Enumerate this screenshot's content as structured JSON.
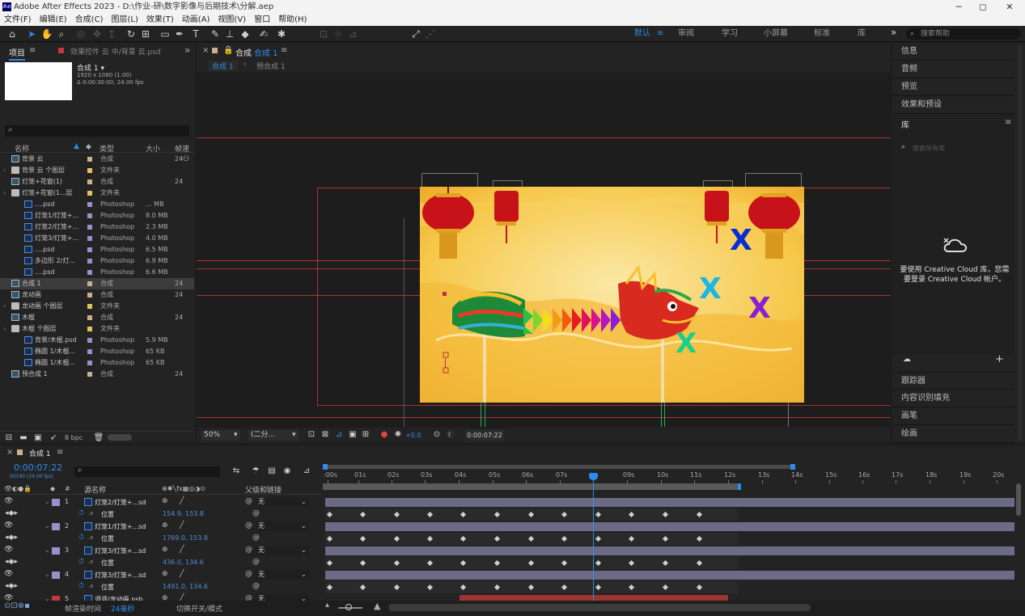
{
  "titlebar": {
    "app_badge": "Ae",
    "title": "Adobe After Effects 2023 - D:\\作业-研\\数字影像与后期技术\\分解.aep",
    "minimize": "─",
    "maximize": "◻",
    "close": "✕"
  },
  "menu": [
    "文件(F)",
    "编辑(E)",
    "合成(C)",
    "图层(L)",
    "效果(T)",
    "动画(A)",
    "视图(V)",
    "窗口",
    "帮助(H)"
  ],
  "toolbar": {
    "snap_label": "对齐",
    "workspaces": [
      "默认",
      "审阅",
      "学习",
      "小屏幕",
      "标准",
      "库"
    ],
    "search_placeholder": "搜索帮助",
    "more": "»"
  },
  "project": {
    "tab_project": "项目",
    "tab_effects": "效果控件 云 中/背景 云.psd",
    "more": "»",
    "comp_name": "合成 1 ▾",
    "comp_info1": "1920 x 1080 (1.00)",
    "comp_info2": "Δ 0:00:30:00, 24.00 fps",
    "search_icon": "⌕",
    "cols": {
      "name": "名称",
      "type": "类型",
      "size": "大小",
      "fr": "帧速"
    },
    "items": [
      {
        "name": "背景 云",
        "type": "合成",
        "size": "",
        "fr": "24",
        "icon": "comp",
        "indent": 0,
        "color": "#c8b18a"
      },
      {
        "name": "背景 云 个图层",
        "type": "文件夹",
        "size": "",
        "fr": "",
        "icon": "fold",
        "indent": 0,
        "color": "#e0c35b"
      },
      {
        "name": "灯笼+花窗(1)",
        "type": "合成",
        "size": "",
        "fr": "24",
        "icon": "comp",
        "indent": 0,
        "color": "#c8b18a"
      },
      {
        "name": "灯笼+花窗(1...层",
        "type": "文件夹",
        "size": "",
        "fr": "",
        "icon": "fold",
        "indent": 0,
        "color": "#e0c35b"
      },
      {
        "name": "....psd",
        "type": "Photoshop",
        "size": "... MB",
        "fr": "",
        "icon": "psd",
        "indent": 1,
        "color": "#9a8fc8"
      },
      {
        "name": "灯笼1/灯笼+...",
        "type": "Photoshop",
        "size": "8.0 MB",
        "fr": "",
        "icon": "psd",
        "indent": 1,
        "color": "#9a8fc8"
      },
      {
        "name": "灯笼2/灯笼+...",
        "type": "Photoshop",
        "size": "2.3 MB",
        "fr": "",
        "icon": "psd",
        "indent": 1,
        "color": "#9a8fc8"
      },
      {
        "name": "灯笼3/灯笼+...",
        "type": "Photoshop",
        "size": "4.0 MB",
        "fr": "",
        "icon": "psd",
        "indent": 1,
        "color": "#9a8fc8"
      },
      {
        "name": "....psd",
        "type": "Photoshop",
        "size": "6.5 MB",
        "fr": "",
        "icon": "psd",
        "indent": 1,
        "color": "#9a8fc8"
      },
      {
        "name": "多边形 2/灯...",
        "type": "Photoshop",
        "size": "6.9 MB",
        "fr": "",
        "icon": "psd",
        "indent": 1,
        "color": "#9a8fc8"
      },
      {
        "name": "....psd",
        "type": "Photoshop",
        "size": "6.6 MB",
        "fr": "",
        "icon": "psd",
        "indent": 1,
        "color": "#9a8fc8"
      },
      {
        "name": "合成 1",
        "type": "合成",
        "size": "",
        "fr": "24",
        "icon": "comp",
        "indent": 0,
        "color": "#c8b18a",
        "selected": true
      },
      {
        "name": "龙动画",
        "type": "合成",
        "size": "",
        "fr": "24",
        "icon": "comp",
        "indent": 0,
        "color": "#c8b18a"
      },
      {
        "name": "龙动画 个图层",
        "type": "文件夹",
        "size": "",
        "fr": "",
        "icon": "fold",
        "indent": 0,
        "color": "#e0c35b"
      },
      {
        "name": "木棍",
        "type": "合成",
        "size": "",
        "fr": "24",
        "icon": "comp",
        "indent": 0,
        "color": "#c8b18a"
      },
      {
        "name": "木棍 个图层",
        "type": "文件夹",
        "size": "",
        "fr": "",
        "icon": "fold",
        "indent": 0,
        "color": "#e0c35b"
      },
      {
        "name": "背景/木棍.psd",
        "type": "Photoshop",
        "size": "5.9 MB",
        "fr": "",
        "icon": "psd",
        "indent": 1,
        "color": "#9a8fc8"
      },
      {
        "name": "椭圆 1/木棍...",
        "type": "Photoshop",
        "size": "65 KB",
        "fr": "",
        "icon": "psd",
        "indent": 1,
        "color": "#9a8fc8"
      },
      {
        "name": "椭圆 1/木棍...",
        "type": "Photoshop",
        "size": "65 KB",
        "fr": "",
        "icon": "psd",
        "indent": 1,
        "color": "#9a8fc8"
      },
      {
        "name": "预合成 1",
        "type": "合成",
        "size": "",
        "fr": "24",
        "icon": "comp",
        "indent": 0,
        "color": "#c8b18a"
      }
    ],
    "bpc": "8 bpc"
  },
  "viewer": {
    "tab": "合成",
    "tab_active": "合成 1",
    "crumb1": "合成 1",
    "crumb2": "预合成 1",
    "zoom": "50%",
    "resolution": "(二分...",
    "exposure": "+0.0",
    "timecode": "0:00:07:22"
  },
  "canvas": {
    "letter": "X",
    "colors": [
      "#0a2cd6",
      "#19b6e8",
      "#8a1fd1",
      "#18d08a"
    ]
  },
  "right_panels": {
    "top": [
      "信息",
      "音频",
      "预览",
      "效果和预设"
    ],
    "library": "库",
    "lib_search": "搜索所有库",
    "cc_msg": "要使用 Creative Cloud 库，您需要登录 Creative Cloud 帐户。",
    "bottom": [
      "跟踪器",
      "内容识别填充",
      "画笔",
      "绘画"
    ]
  },
  "timeline": {
    "tab": "合成 1",
    "timecode": "0:00:07:22",
    "frames": "00190 (24.00 fps)",
    "cols": {
      "src": "源名称",
      "parent": "父级和链接"
    },
    "ruler": [
      ":00s",
      "01s",
      "02s",
      "03s",
      "04s",
      "05s",
      "06s",
      "07s",
      "09s",
      "10s",
      "11s",
      "12s",
      "13s",
      "14s",
      "15s",
      "16s",
      "17s",
      "18s",
      "19s",
      "20s"
    ],
    "layers": [
      {
        "num": "1",
        "name": "灯笼2/灯笼+...sd",
        "parent": "无",
        "color": "#9a8fc8",
        "prop": "位置",
        "val": "154.9, 153.8"
      },
      {
        "num": "2",
        "name": "灯笼1/灯笼+...sd",
        "parent": "无",
        "color": "#9a8fc8",
        "prop": "位置",
        "val": "1769.0, 153.8"
      },
      {
        "num": "3",
        "name": "灯笼3/灯笼+...sd",
        "parent": "无",
        "color": "#9a8fc8",
        "prop": "位置",
        "val": "436.0, 134.6"
      },
      {
        "num": "4",
        "name": "灯笼3/灯笼+...sd",
        "parent": "无",
        "color": "#9a8fc8",
        "prop": "位置",
        "val": "1491.0, 134.6"
      },
      {
        "num": "5",
        "name": "须须/龙动画.psb",
        "parent": "无",
        "color": "#c23a3a"
      }
    ],
    "render_label": "帧渲染时间",
    "render_value": "24毫秒",
    "switch_label": "切换开关/模式"
  }
}
